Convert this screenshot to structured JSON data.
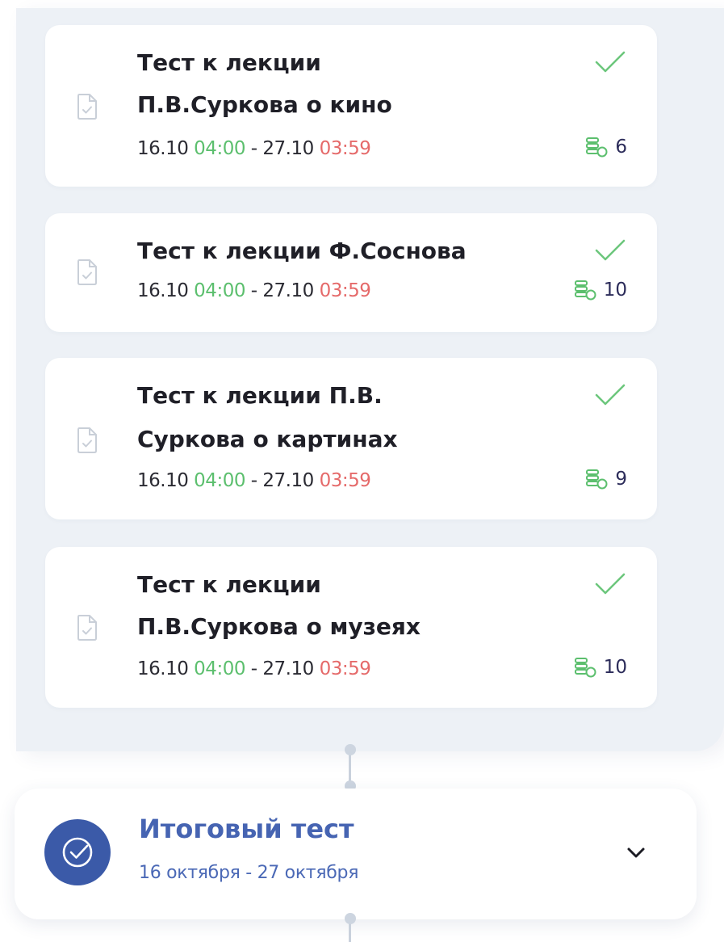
{
  "tasks": [
    {
      "title_lines": [
        "Тест к лекции",
        "П.В.Суркова о кино"
      ],
      "date_start": "16.10",
      "time_start": "04:00",
      "separator": " - ",
      "date_end": "27.10",
      "time_end": "03:59",
      "points": "6",
      "status_icon": "check-icon",
      "type_icon": "document-icon",
      "points_icon": "coins-icon"
    },
    {
      "title_lines": [
        "Тест к лекции Ф.Соснова"
      ],
      "date_start": "16.10",
      "time_start": "04:00",
      "separator": " - ",
      "date_end": "27.10",
      "time_end": "03:59",
      "points": "10",
      "status_icon": "check-icon",
      "type_icon": "document-icon",
      "points_icon": "coins-icon"
    },
    {
      "title_lines": [
        "Тест к лекции П.В.",
        "Суркова о картинах"
      ],
      "date_start": "16.10",
      "time_start": "04:00",
      "separator": " - ",
      "date_end": "27.10",
      "time_end": "03:59",
      "points": "9",
      "status_icon": "check-icon",
      "type_icon": "document-icon",
      "points_icon": "coins-icon"
    },
    {
      "title_lines": [
        "Тест к лекции",
        "П.В.Суркова о музеях"
      ],
      "date_start": "16.10",
      "time_start": "04:00",
      "separator": " - ",
      "date_end": "27.10",
      "time_end": "03:59",
      "points": "10",
      "status_icon": "check-icon",
      "type_icon": "document-icon",
      "points_icon": "coins-icon"
    }
  ],
  "final_test": {
    "title": "Итоговый тест",
    "dates": "16 октября - 27 октября",
    "badge_icon": "check-circle-icon",
    "toggle_icon": "chevron-down-icon"
  },
  "colors": {
    "panel_bg": "#edf1f6",
    "start_time": "#5cbf6e",
    "end_time": "#e56a6a",
    "accent": "#3b5aa8",
    "check": "#6cc67c"
  }
}
